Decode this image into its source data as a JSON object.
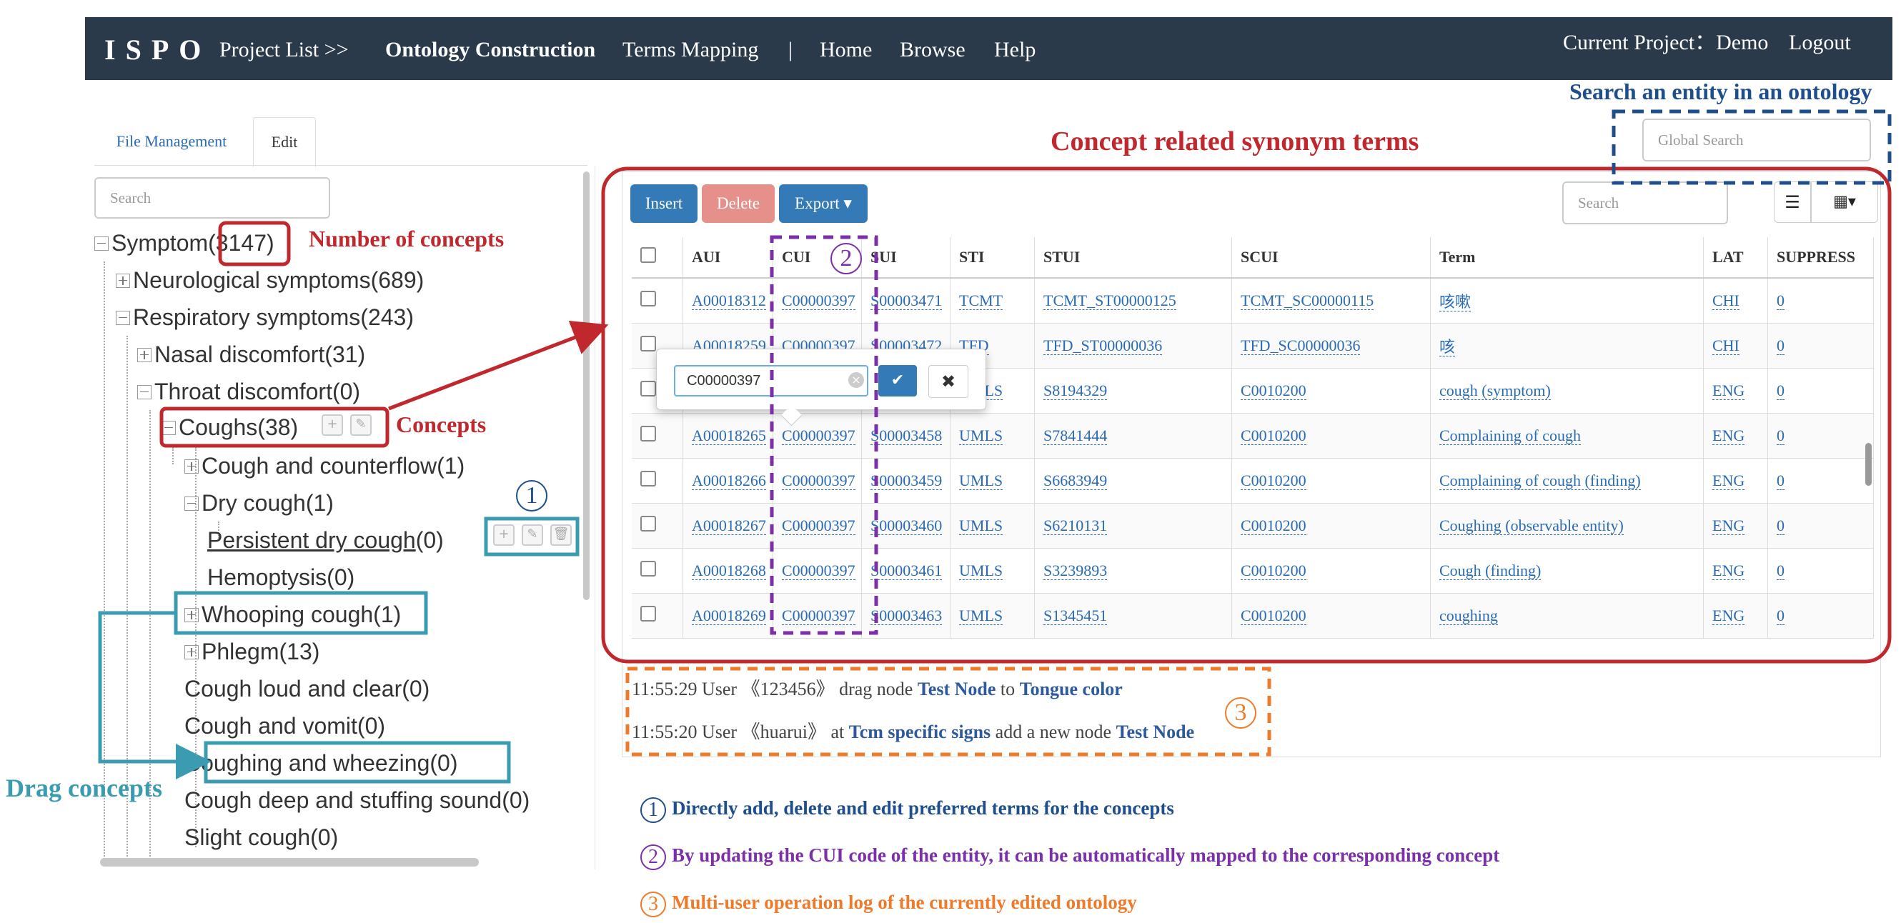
{
  "nav": {
    "logo": "ISPO",
    "project_list": "Project List >>",
    "ontology_construction": "Ontology Construction",
    "terms_mapping": "Terms Mapping",
    "separator": "|",
    "home": "Home",
    "browse": "Browse",
    "help": "Help",
    "current_project": "Current Project：Demo",
    "logout": "Logout"
  },
  "tabs": {
    "file_management": "File Management",
    "edit": "Edit"
  },
  "tree_search_placeholder": "Search",
  "global_search_placeholder": "Global Search",
  "table_search_placeholder": "Search",
  "tree": [
    {
      "label": "Symptom",
      "count": "(3147)",
      "toggle": "minus"
    },
    {
      "label": "Neurological symptoms",
      "count": "(689)",
      "toggle": "plus"
    },
    {
      "label": "Respiratory symptoms",
      "count": "(243)",
      "toggle": "minus"
    },
    {
      "label": "Nasal discomfort",
      "count": "(31)",
      "toggle": "plus"
    },
    {
      "label": "Throat discomfort",
      "count": "(0)",
      "toggle": "minus"
    },
    {
      "label": "Coughs",
      "count": "(38)",
      "toggle": "minus"
    },
    {
      "label": "Cough and counterflow",
      "count": "(1)",
      "toggle": "plus"
    },
    {
      "label": "Dry cough",
      "count": "(1)",
      "toggle": "minus"
    },
    {
      "label": "Persistent dry cough",
      "count": "(0)",
      "toggle": "leaf"
    },
    {
      "label": "Hemoptysis",
      "count": "(0)",
      "toggle": "leaf"
    },
    {
      "label": "Whooping cough",
      "count": "(1)",
      "toggle": "plus"
    },
    {
      "label": "Phlegm",
      "count": "(13)",
      "toggle": "plus"
    },
    {
      "label": "Cough loud and clear",
      "count": "(0)",
      "toggle": "leaf"
    },
    {
      "label": "Cough and vomit",
      "count": "(0)",
      "toggle": "leaf"
    },
    {
      "label": "Coughing and wheezing",
      "count": "(0)",
      "toggle": "leaf"
    },
    {
      "label": "Cough deep and stuffing sound",
      "count": "(0)",
      "toggle": "leaf"
    },
    {
      "label": "Slight cough",
      "count": "(0)",
      "toggle": "leaf"
    }
  ],
  "toolbar": {
    "insert": "Insert",
    "delete": "Delete",
    "export": "Export ▾"
  },
  "table": {
    "columns": [
      "AUI",
      "CUI",
      "SUI",
      "STI",
      "STUI",
      "SCUI",
      "Term",
      "LAT",
      "SUPPRESS"
    ],
    "rows": [
      [
        "A00018312",
        "C00000397",
        "S00003471",
        "TCMT",
        "TCMT_ST00000125",
        "TCMT_SC00000115",
        "咳嗽",
        "CHI",
        "0"
      ],
      [
        "A00018259",
        "C00000397",
        "S00003472",
        "TFD",
        "TFD_ST00000036",
        "TFD_SC00000036",
        "咳",
        "CHI",
        "0"
      ],
      [
        "",
        "",
        "",
        "UMLS",
        "S8194329",
        "C0010200",
        "cough (symptom)",
        "ENG",
        "0"
      ],
      [
        "A00018265",
        "C00000397",
        "S00003458",
        "UMLS",
        "S7841444",
        "C0010200",
        "Complaining of cough",
        "ENG",
        "0"
      ],
      [
        "A00018266",
        "C00000397",
        "S00003459",
        "UMLS",
        "S6683949",
        "C0010200",
        "Complaining of cough (finding)",
        "ENG",
        "0"
      ],
      [
        "A00018267",
        "C00000397",
        "S00003460",
        "UMLS",
        "S6210131",
        "C0010200",
        "Coughing (observable entity)",
        "ENG",
        "0"
      ],
      [
        "A00018268",
        "C00000397",
        "S00003461",
        "UMLS",
        "S3239893",
        "C0010200",
        "Cough (finding)",
        "ENG",
        "0"
      ],
      [
        "A00018269",
        "C00000397",
        "S00003463",
        "UMLS",
        "S1345451",
        "C0010200",
        "coughing",
        "ENG",
        "0"
      ]
    ]
  },
  "popover": {
    "value": "C00000397",
    "ok_icon": "✔",
    "cancel_icon": "✖",
    "clear_icon": "×"
  },
  "log": [
    {
      "time": "11:55:29 User 《123456》 drag node",
      "node": "Test Node",
      "mid": "to",
      "target": "Tongue color"
    },
    {
      "time": "11:55:20 User 《huarui》 at",
      "node": "Tcm specific signs",
      "mid": "add a new node",
      "target": "Test Node"
    }
  ],
  "annotations": {
    "concept_synonyms": "Concept related synonym terms",
    "search_entity": "Search an entity in an ontology",
    "number_of_concepts": "Number of concepts",
    "concepts": "Concepts",
    "drag_concepts": "Drag concepts",
    "circle1": "1",
    "circle2": "2",
    "circle3": "3",
    "note1": "Directly add, delete and edit preferred terms for the concepts",
    "note2": "By updating the CUI code of the entity, it can be automatically mapped to the corresponding concept",
    "note3": "Multi-user operation log of the currently edited ontology"
  },
  "colors": {
    "nav": "#2b3a4b",
    "red": "#c0282d",
    "teal": "#3b9bb0",
    "purple": "#7b2fa8",
    "orange": "#ee7a2a",
    "navy": "#1f4e8c",
    "insert": "#337ab7",
    "delete": "#e6908c"
  }
}
